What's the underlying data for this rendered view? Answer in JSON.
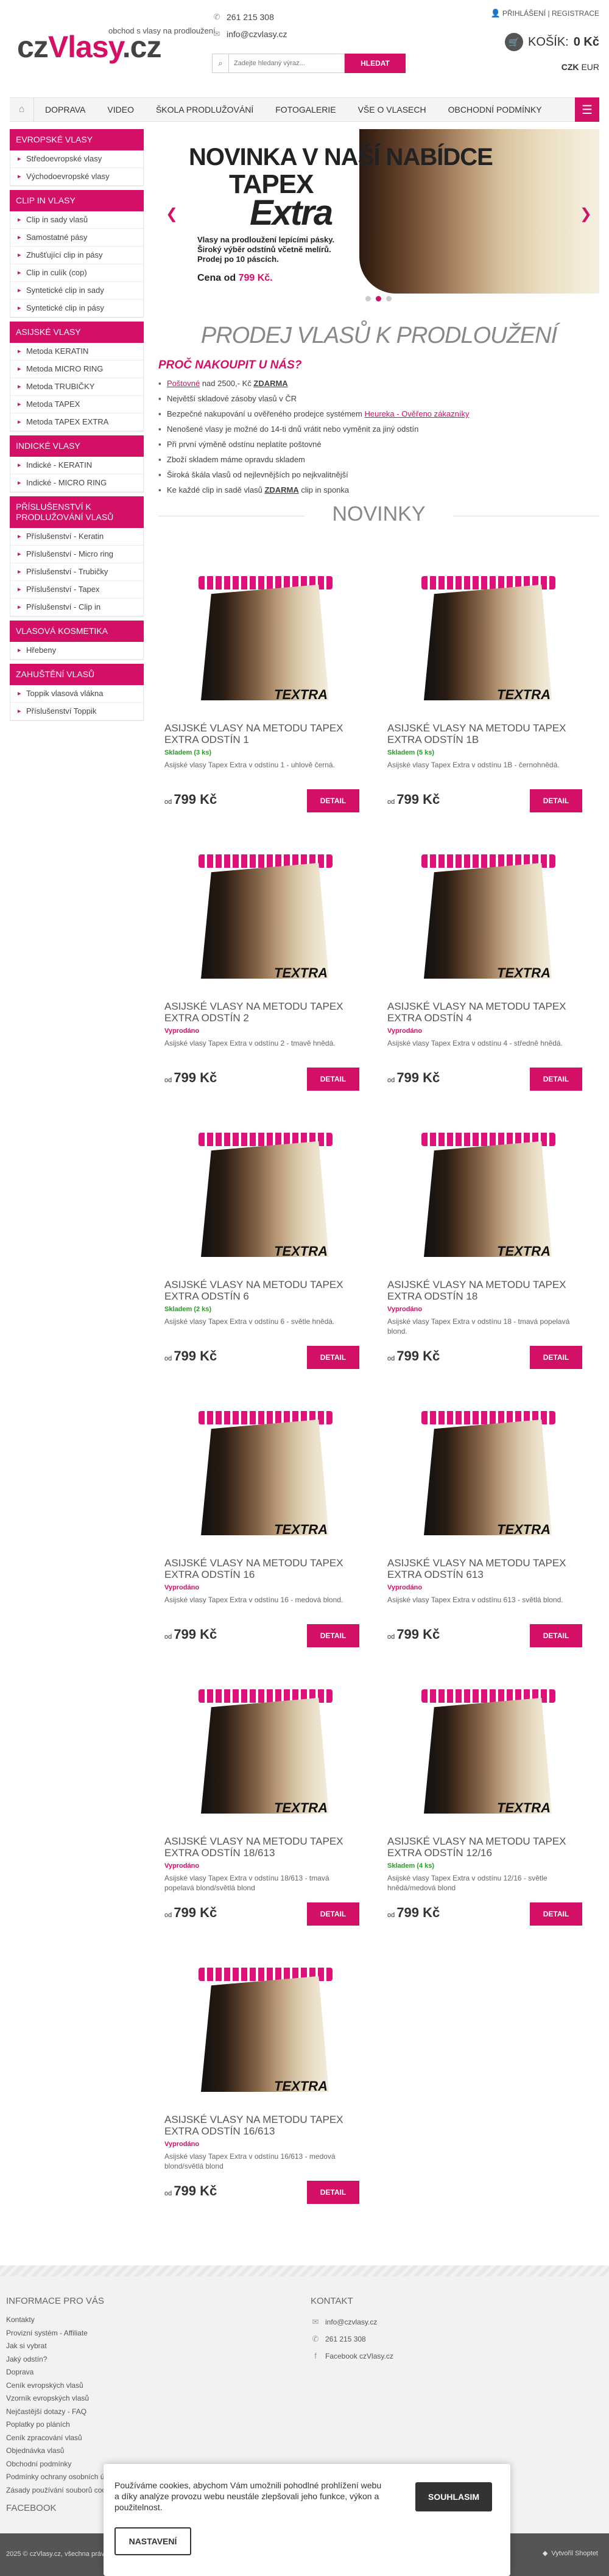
{
  "header": {
    "logo_cz": "cz",
    "logo_vlasy": "Vlasy",
    "logo_dotcz": ".cz",
    "tagline": "obchod s vlasy na prodloužení",
    "phone": "261 215 308",
    "email": "info@czvlasy.cz",
    "search_placeholder": "Zadejte hledaný výraz...",
    "search_button": "HLEDAT",
    "login": "PŘIHLÁŠENÍ",
    "register": "REGISTRACE",
    "cart_label": "KOŠÍK:",
    "cart_value": "0 Kč",
    "currency_czk": "CZK",
    "currency_eur": "EUR"
  },
  "nav": {
    "items": [
      "DOPRAVA",
      "VIDEO",
      "ŠKOLA PRODLUŽOVÁNÍ",
      "FOTOGALERIE",
      "VŠE O VLASECH",
      "OBCHODNÍ PODMÍNKY"
    ]
  },
  "sidebar": [
    {
      "title": "EVROPSKÉ VLASY",
      "items": [
        "Středoevropské vlasy",
        "Východoevropské vlasy"
      ]
    },
    {
      "title": "CLIP IN VLASY",
      "items": [
        "Clip in sady vlasů",
        "Samostatné pásy",
        "Zhušťující clip in pásy",
        "Clip in culík (cop)",
        "Syntetické clip in sady",
        "Syntetické clip in pásy"
      ]
    },
    {
      "title": "ASIJSKÉ VLASY",
      "items": [
        "Metoda KERATIN",
        "Metoda MICRO RING",
        "Metoda TRUBIČKY",
        "Metoda TAPEX",
        "Metoda TAPEX EXTRA"
      ]
    },
    {
      "title": "INDICKÉ VLASY",
      "items": [
        "Indické - KERATIN",
        "Indické - MICRO RING"
      ]
    },
    {
      "title": "PŘÍSLUŠENSTVÍ K PRODLUŽOVÁNÍ VLASŮ",
      "items": [
        "Příslušenství - Keratin",
        "Příslušenství - Micro ring",
        "Příslušenství - Trubičky",
        "Příslušenství - Tapex",
        "Příslušenství - Clip in"
      ]
    },
    {
      "title": "VLASOVÁ KOSMETIKA",
      "items": [
        "Hřebeny"
      ]
    },
    {
      "title": "ZAHUŠTĚNÍ VLASŮ",
      "items": [
        "Toppik vlasová vlákna",
        "Příslušenství Toppik"
      ]
    }
  ],
  "banner": {
    "line1": "NOVINKA V NAŠÍ NABÍDCE",
    "line2": "TAPEX",
    "line3": "Extra",
    "desc1": "Vlasy na prodloužení lepícími pásky.",
    "desc2": "Široký výběr odstínů včetně melírů.",
    "desc3": "Prodej po 10 páscích.",
    "price_label": "Cena od",
    "price": "799 Kč."
  },
  "main": {
    "title": "PRODEJ VLASŮ K PRODLOUŽENÍ",
    "why_title": "PROČ NAKOUPIT U NÁS?",
    "why_items": [
      [
        "Poštovné",
        " nad 2500,- Kč ",
        "ZDARMA"
      ],
      "Největší skladové zásoby vlasů v ČR",
      [
        "Bezpečné nakupování u ověřeného prodejce systémem ",
        "Heureka - Ověřeno zákazníky",
        ""
      ],
      "Nenošené vlasy je možné do 14-ti dnů vrátit nebo vyměnit za jiný odstín",
      "Při první výměně odstínu neplatíte poštovné",
      "Zboží skladem máme opravdu skladem",
      "Široká škála vlasů od nejlevnějších po nejkvalitnější",
      [
        "Ke každé clip in sadě vlasů ",
        "ZDARMA",
        " clip in sponka"
      ]
    ],
    "novinky": "NOVINKY"
  },
  "products": [
    {
      "name": "ASIJSKÉ VLASY NA METODU TAPEX EXTRA ODSTÍN 1",
      "stock": "Skladem (3 ks)",
      "in": true,
      "desc": "Asijské vlasy Tapex Extra v odstínu 1 - uhlově černá.",
      "price_from": "od",
      "price": "799 Kč",
      "btn": "DETAIL"
    },
    {
      "name": "ASIJSKÉ VLASY NA METODU TAPEX EXTRA ODSTÍN 1B",
      "stock": "Skladem (5 ks)",
      "in": true,
      "desc": "Asijské vlasy Tapex Extra v odstínu 1B - černohnědá.",
      "price_from": "od",
      "price": "799 Kč",
      "btn": "DETAIL"
    },
    {
      "name": "ASIJSKÉ VLASY NA METODU TAPEX EXTRA ODSTÍN 2",
      "stock": "Vyprodáno",
      "in": false,
      "desc": "Asijské vlasy Tapex Extra v odstínu 2 - tmavě hnědá.",
      "price_from": "od",
      "price": "799 Kč",
      "btn": "DETAIL"
    },
    {
      "name": "ASIJSKÉ VLASY NA METODU TAPEX EXTRA ODSTÍN 4",
      "stock": "Vyprodáno",
      "in": false,
      "desc": "Asijské vlasy Tapex Extra v odstínu 4 - středně hnědá.",
      "price_from": "od",
      "price": "799 Kč",
      "btn": "DETAIL"
    },
    {
      "name": "ASIJSKÉ VLASY NA METODU TAPEX EXTRA ODSTÍN 6",
      "stock": "Skladem (2 ks)",
      "in": true,
      "desc": "Asijské vlasy Tapex Extra v odstínu 6 - světle hnědá.",
      "price_from": "od",
      "price": "799 Kč",
      "btn": "DETAIL"
    },
    {
      "name": "ASIJSKÉ VLASY NA METODU TAPEX EXTRA ODSTÍN 18",
      "stock": "Vyprodáno",
      "in": false,
      "desc": "Asijské vlasy Tapex Extra v odstínu 18 - tmavá popelavá blond.",
      "price_from": "od",
      "price": "799 Kč",
      "btn": "DETAIL"
    },
    {
      "name": "ASIJSKÉ VLASY NA METODU TAPEX EXTRA ODSTÍN 16",
      "stock": "Vyprodáno",
      "in": false,
      "desc": "Asijské vlasy Tapex Extra v odstínu 16 - medová blond.",
      "price_from": "od",
      "price": "799 Kč",
      "btn": "DETAIL"
    },
    {
      "name": "ASIJSKÉ VLASY NA METODU TAPEX EXTRA ODSTÍN 613",
      "stock": "Vyprodáno",
      "in": false,
      "desc": "Asijské vlasy Tapex Extra v odstínu 613 - světlá blond.",
      "price_from": "od",
      "price": "799 Kč",
      "btn": "DETAIL"
    },
    {
      "name": "ASIJSKÉ VLASY NA METODU TAPEX EXTRA ODSTÍN 18/613",
      "stock": "Vyprodáno",
      "in": false,
      "desc": "Asijské vlasy Tapex Extra v odstínu 18/613 - tmavá popelavá blond/světlá blond",
      "price_from": "od",
      "price": "799 Kč",
      "btn": "DETAIL"
    },
    {
      "name": "ASIJSKÉ VLASY NA METODU TAPEX EXTRA ODSTÍN 12/16",
      "stock": "Skladem (4 ks)",
      "in": true,
      "desc": "Asijské vlasy Tapex Extra v odstínu 12/16 - světle hnědá/medová blond",
      "price_from": "od",
      "price": "799 Kč",
      "btn": "DETAIL"
    },
    {
      "name": "ASIJSKÉ VLASY NA METODU TAPEX EXTRA ODSTÍN 16/613",
      "stock": "Vyprodáno",
      "in": false,
      "desc": "Asijské vlasy Tapex Extra v odstínu 16/613 - medová blond/světlá blond",
      "price_from": "od",
      "price": "799 Kč",
      "btn": "DETAIL"
    }
  ],
  "footer": {
    "info_title": "INFORMACE PRO VÁS",
    "info_links": [
      "Kontakty",
      "Provizní systém - Affiliate",
      "Jak si vybrat",
      "Jaký odstín?",
      "Doprava",
      "Ceník evropských vlasů",
      "Vzorník evropských vlasů",
      "Nejčastější dotazy - FAQ",
      "Poplatky po pláních",
      "Ceník zpracování vlasů",
      "Objednávka vlasů",
      "Obchodní podmínky",
      "Podmínky ochrany osobních údajů",
      "Zásady používání souborů cookies"
    ],
    "contact_title": "KONTAKT",
    "contact_email": "info@czvlasy.cz",
    "contact_phone": "261 215 308",
    "contact_fb": "Facebook czVlasy.cz",
    "facebook_title": "FACEBOOK",
    "copyright": "2025 © czVlasy.cz, všechna práva vyhrazena",
    "shoptet": "Vytvořil Shoptet"
  },
  "cookie": {
    "text": "Používáme cookies, abychom Vám umožnili pohodlné prohlížení webu a díky analýze provozu webu neustále zlepšovali jeho funkce, výkon a použitelnost.",
    "agree": "SOUHLASIM",
    "settings": "NASTAVENÍ"
  },
  "colors": {
    "accent": "#d30f66"
  }
}
